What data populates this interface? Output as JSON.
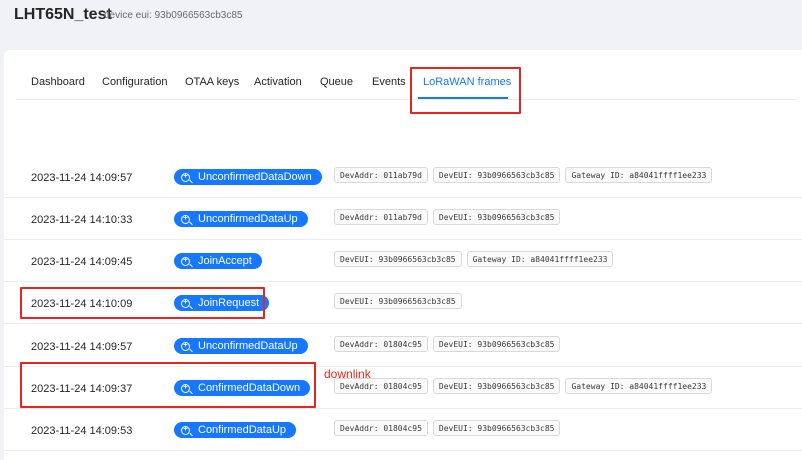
{
  "header": {
    "title": "LHT65N_test",
    "subtitle": "device eui: 93b0966563cb3c85"
  },
  "tabs": [
    {
      "label": "Dashboard"
    },
    {
      "label": "Configuration"
    },
    {
      "label": "OTAA keys"
    },
    {
      "label": "Activation"
    },
    {
      "label": "Queue"
    },
    {
      "label": "Events"
    },
    {
      "label": "LoRaWAN frames",
      "active": true
    }
  ],
  "frames": [
    {
      "time": "2023-11-24 14:09:57",
      "type": "UnconfirmedDataDown",
      "tags": [
        "DevAddr: 011ab79d",
        "DevEUI: 93b0966563cb3c85",
        "Gateway ID: a84041ffff1ee233"
      ]
    },
    {
      "time": "2023-11-24 14:10:33",
      "type": "UnconfirmedDataUp",
      "tags": [
        "DevAddr: 011ab79d",
        "DevEUI: 93b0966563cb3c85"
      ]
    },
    {
      "time": "2023-11-24 14:09:45",
      "type": "JoinAccept",
      "tags": [
        "DevEUI: 93b0966563cb3c85",
        "Gateway ID: a84041ffff1ee233"
      ]
    },
    {
      "time": "2023-11-24 14:10:09",
      "type": "JoinRequest",
      "tags": [
        "DevEUI: 93b0966563cb3c85"
      ]
    },
    {
      "time": "2023-11-24 14:09:57",
      "type": "UnconfirmedDataUp",
      "tags": [
        "DevAddr: 01804c95",
        "DevEUI: 93b0966563cb3c85"
      ]
    },
    {
      "time": "2023-11-24 14:09:37",
      "type": "ConfirmedDataDown",
      "tags": [
        "DevAddr: 01804c95",
        "DevEUI: 93b0966563cb3c85",
        "Gateway ID: a84041ffff1ee233"
      ]
    },
    {
      "time": "2023-11-24 14:09:53",
      "type": "ConfirmedDataUp",
      "tags": [
        "DevAddr: 01804c95",
        "DevEUI: 93b0966563cb3c85"
      ]
    }
  ],
  "annotation": "downlink",
  "colors": {
    "accent": "#1677ff",
    "highlight": "#e8261d"
  },
  "icons": {
    "frame_button": "zoom-in-icon"
  }
}
